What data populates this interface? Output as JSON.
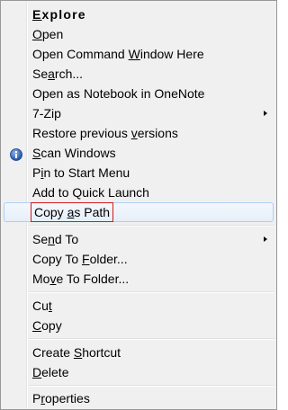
{
  "menu": {
    "items": [
      {
        "id": "explore",
        "pre": "",
        "acc": "E",
        "post": "xplore",
        "bold": true
      },
      {
        "id": "open",
        "pre": "",
        "acc": "O",
        "post": "pen"
      },
      {
        "id": "open-command-window",
        "pre": "Open Command ",
        "acc": "W",
        "post": "indow Here"
      },
      {
        "id": "search",
        "pre": "Se",
        "acc": "a",
        "post": "rch..."
      },
      {
        "id": "open-onenote",
        "pre": "Open as Notebook in OneNote",
        "acc": "",
        "post": ""
      },
      {
        "id": "7zip",
        "pre": "7-Zip",
        "acc": "",
        "post": "",
        "submenu": true
      },
      {
        "id": "restore-versions",
        "pre": "Restore previous ",
        "acc": "v",
        "post": "ersions"
      },
      {
        "id": "scan-windows",
        "pre": "",
        "acc": "S",
        "post": "can Windows",
        "icon": "info-shield-icon"
      },
      {
        "id": "pin-start",
        "pre": "P",
        "acc": "i",
        "post": "n to Start Menu"
      },
      {
        "id": "add-quick-launch",
        "pre": "Add to Quick Launch",
        "acc": "",
        "post": ""
      },
      {
        "id": "copy-as-path",
        "pre": "Copy ",
        "acc": "a",
        "post": "s Path",
        "highlighted": true
      },
      {
        "id": "send-to",
        "pre": "Se",
        "acc": "n",
        "post": "d To",
        "submenu": true
      },
      {
        "id": "copy-to-folder",
        "pre": "Copy To ",
        "acc": "F",
        "post": "older..."
      },
      {
        "id": "move-to-folder",
        "pre": "Mo",
        "acc": "v",
        "post": "e To Folder..."
      },
      {
        "id": "cut",
        "pre": "Cu",
        "acc": "t",
        "post": ""
      },
      {
        "id": "copy",
        "pre": "",
        "acc": "C",
        "post": "opy"
      },
      {
        "id": "create-shortcut",
        "pre": "Create ",
        "acc": "S",
        "post": "hortcut"
      },
      {
        "id": "delete",
        "pre": "",
        "acc": "D",
        "post": "elete"
      },
      {
        "id": "properties",
        "pre": "P",
        "acc": "r",
        "post": "operties"
      }
    ]
  },
  "colors": {
    "highlight_border": "#aecff7",
    "callout_border": "#d11a1a",
    "menu_background": "#f0f0f0"
  }
}
